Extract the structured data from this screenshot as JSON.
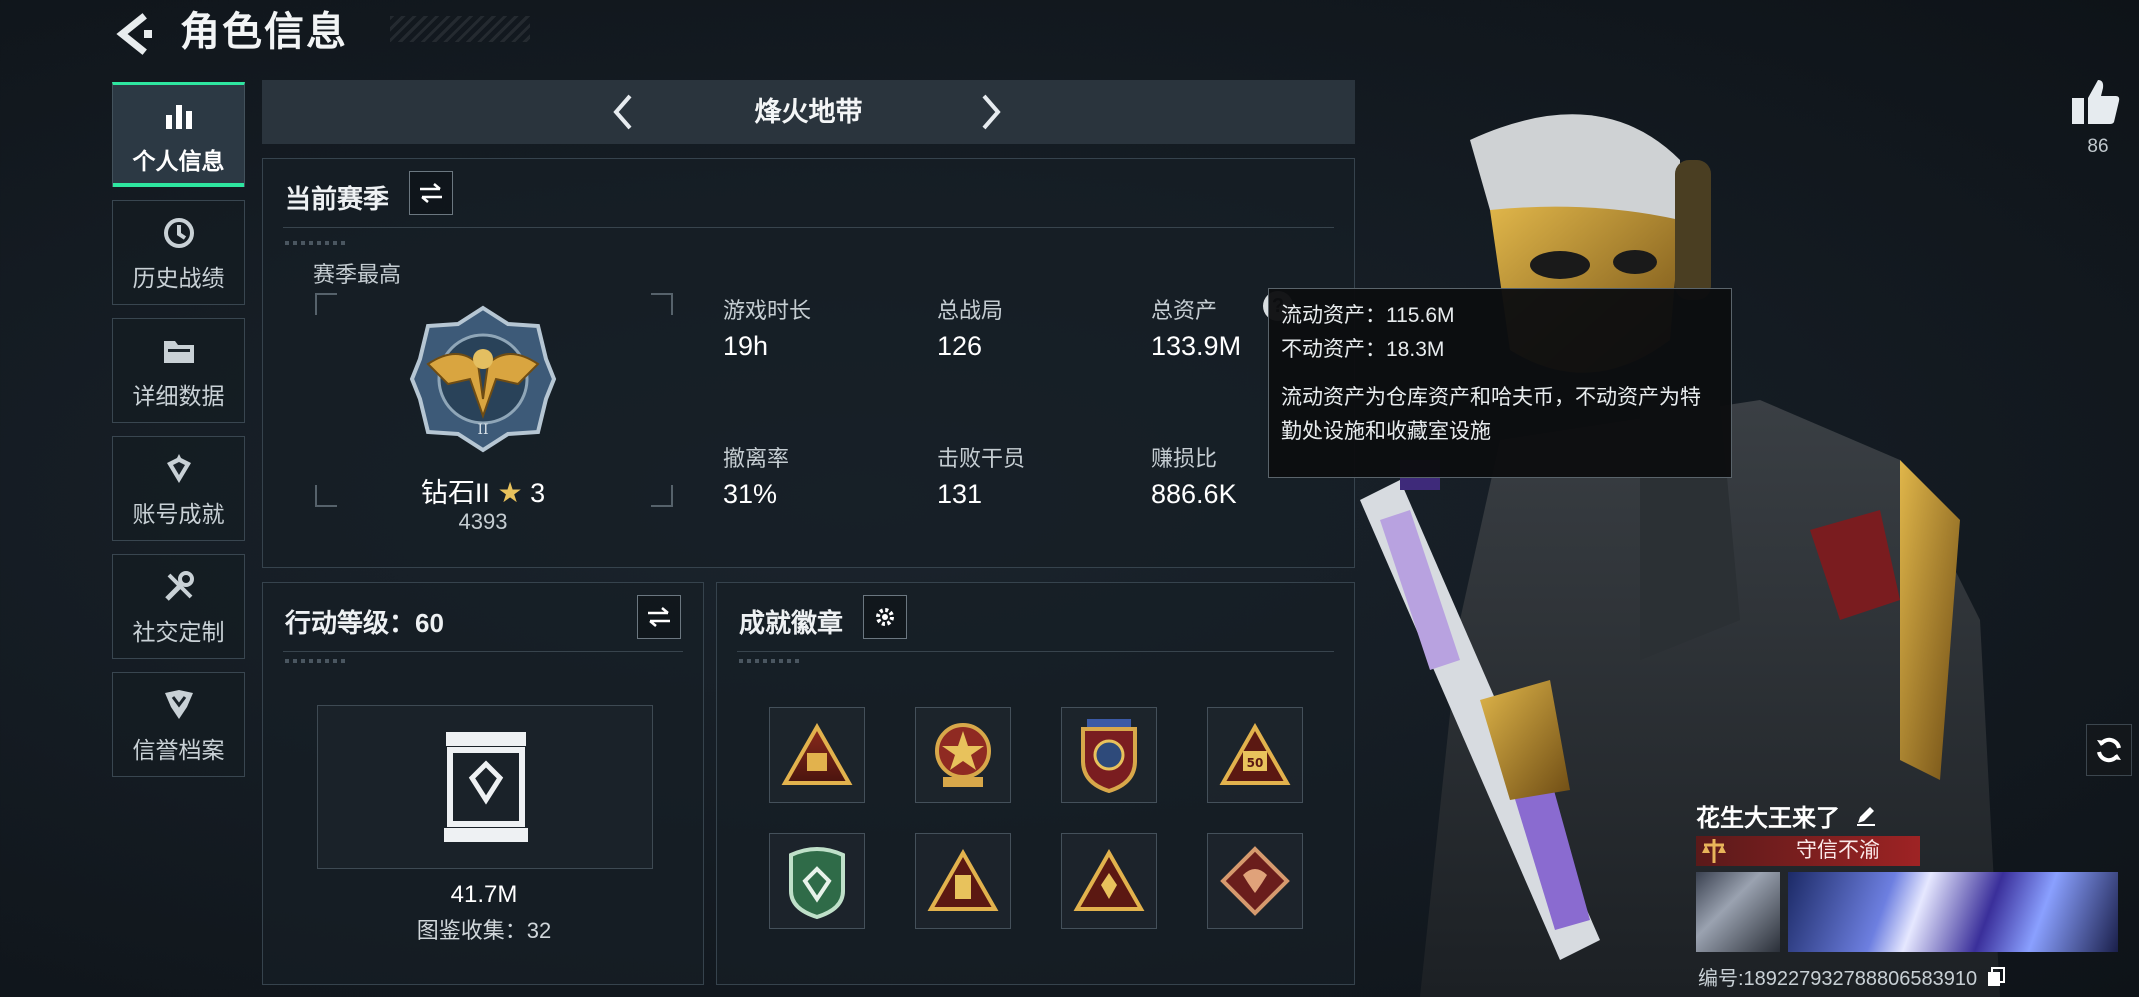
{
  "header": {
    "title": "角色信息"
  },
  "sidebar": {
    "items": [
      {
        "label": "个人信息",
        "icon": "bar-chart-icon",
        "active": true
      },
      {
        "label": "历史战绩",
        "icon": "history-icon"
      },
      {
        "label": "详细数据",
        "icon": "folder-icon"
      },
      {
        "label": "账号成就",
        "icon": "achievement-icon"
      },
      {
        "label": "社交定制",
        "icon": "tools-icon"
      },
      {
        "label": "信誉档案",
        "icon": "shield-icon"
      }
    ]
  },
  "mode": {
    "title": "烽火地带"
  },
  "season": {
    "title": "当前赛季",
    "best_label": "赛季最高",
    "rank_name": "钻石II",
    "rank_stars": "3",
    "rank_score": "4393",
    "stats": [
      {
        "label": "游戏时长",
        "value": "19h"
      },
      {
        "label": "总战局",
        "value": "126"
      },
      {
        "label": "总资产",
        "value": "133.9M"
      },
      {
        "label": "撤离率",
        "value": "31%"
      },
      {
        "label": "击败干员",
        "value": "131"
      },
      {
        "label": "赚损比",
        "value": "886.6K"
      }
    ]
  },
  "tooltip": {
    "line1": "流动资产：115.6M",
    "line2": "不动资产：18.3M",
    "description": "流动资产为仓库资产和哈夫币，不动资产为特勤处设施和收藏室设施"
  },
  "level": {
    "title": "行动等级：60",
    "collection_value": "41.7M",
    "collection_label": "图鉴收集：32"
  },
  "achievements": {
    "title": "成就徽章",
    "badges": [
      "triangle-crate-badge",
      "star-medal-badge",
      "eagle-shield-badge",
      "triangle-50-badge",
      "green-shield-badge",
      "triangle-box-badge",
      "triangle-star-badge",
      "dragon-diamond-badge"
    ]
  },
  "profile": {
    "likes": "86",
    "name": "花生大王来了",
    "honor_title": "守信不渝",
    "id_text": "编号:1892279327888065839​10"
  },
  "colors": {
    "accent": "#2ee6a0",
    "title_red": "#9e2324",
    "panel_border": "#36434d"
  }
}
